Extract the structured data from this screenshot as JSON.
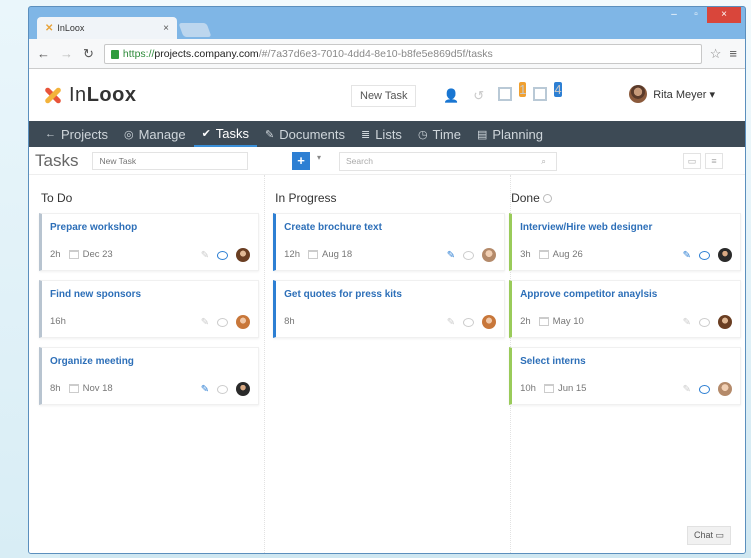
{
  "browser": {
    "tab_title": "InLoox",
    "tab_close": "×",
    "window_buttons": [
      "–",
      "▫",
      "×"
    ],
    "url_scheme": "https://",
    "url_host": "projects.company.com",
    "url_path": "/#/7a37d6e3-7010-4dd4-8e10-b8fe5e869d5f/tasks",
    "star": "☆",
    "menu": "≡"
  },
  "header": {
    "brand_prefix": "In",
    "brand_suffix": "Loox",
    "new_task_label": "New Task",
    "badge_1": "1",
    "badge_2": "4",
    "user_name": "Rita Meyer ▾"
  },
  "nav": [
    {
      "icon": "←",
      "label": "Projects"
    },
    {
      "icon": "◎",
      "label": "Manage"
    },
    {
      "icon": "✔",
      "label": "Tasks",
      "active": true
    },
    {
      "icon": "✎",
      "label": "Documents"
    },
    {
      "icon": "≣",
      "label": "Lists"
    },
    {
      "icon": "◷",
      "label": "Time"
    },
    {
      "icon": "▤",
      "label": "Planning"
    }
  ],
  "toolbar": {
    "page_title": "Tasks",
    "new_task_placeholder": "New Task",
    "add_symbol": "+",
    "caret": "▾",
    "search_placeholder": "Search",
    "search_icon": "⌕"
  },
  "columns": [
    {
      "title": "To Do",
      "cards": [
        {
          "title": "Prepare workshop",
          "duration": "2h",
          "date": "Dec 23",
          "attach": false,
          "comment": true
        },
        {
          "title": "Find new sponsors",
          "duration": "16h",
          "date": "",
          "attach": false,
          "comment": false
        },
        {
          "title": "Organize meeting",
          "duration": "8h",
          "date": "Nov 18",
          "attach": true,
          "comment": false
        }
      ]
    },
    {
      "title": "In Progress",
      "cards": [
        {
          "title": "Create brochure text",
          "duration": "12h",
          "date": "Aug 18",
          "attach": true,
          "comment": false
        },
        {
          "title": "Get quotes for press kits",
          "duration": "8h",
          "date": "",
          "attach": false,
          "comment": false
        }
      ]
    },
    {
      "title": "Done",
      "cards": [
        {
          "title": "Interview/Hire web designer",
          "duration": "3h",
          "date": "Aug 26",
          "attach": true,
          "comment": true
        },
        {
          "title": "Approve competitor anaylsis",
          "duration": "2h",
          "date": "May 10",
          "attach": false,
          "comment": false
        },
        {
          "title": "Select interns",
          "duration": "10h",
          "date": "Jun 15",
          "attach": false,
          "comment": true
        }
      ]
    }
  ],
  "chat_label": "Chat"
}
